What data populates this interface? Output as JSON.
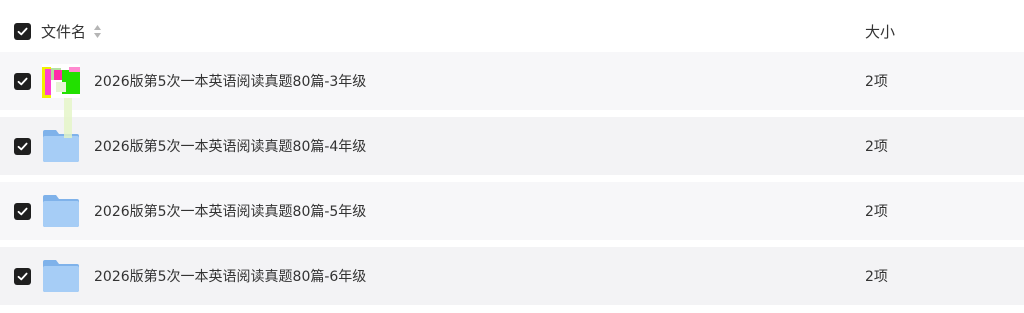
{
  "header": {
    "select_all_checked": true,
    "col_name": "文件名",
    "col_size": "大小"
  },
  "rows": [
    {
      "name": "2026版第5次一本英语阅读真题80篇-3年级",
      "size": "2项",
      "checked": true,
      "icon": "folder-icon"
    },
    {
      "name": "2026版第5次一本英语阅读真题80篇-4年级",
      "size": "2项",
      "checked": true,
      "icon": "folder-icon"
    },
    {
      "name": "2026版第5次一本英语阅读真题80篇-5年级",
      "size": "2项",
      "checked": true,
      "icon": "folder-icon"
    },
    {
      "name": "2026版第5次一本英语阅读真题80篇-6年级",
      "size": "2项",
      "checked": true,
      "icon": "folder-icon"
    }
  ],
  "colors": {
    "checkbox": "#1f1f1f",
    "row_bg": "#f7f7f9",
    "row_bg_alt": "#f3f3f5",
    "folder": "#8fbef2"
  }
}
